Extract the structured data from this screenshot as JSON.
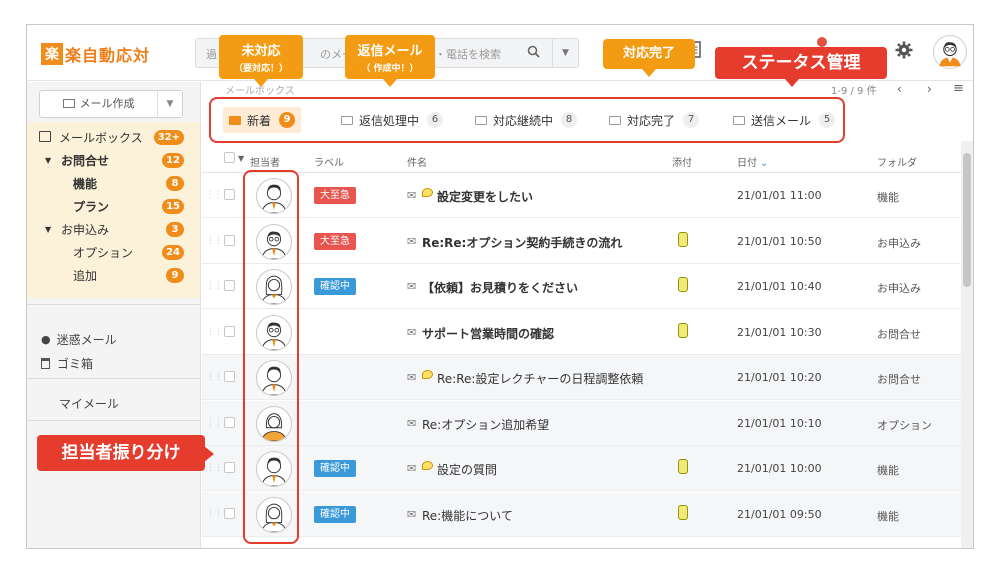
{
  "app": {
    "logo_mark": "楽",
    "logo_name": "楽自動応対"
  },
  "search": {
    "placeholder_left": "過",
    "placeholder_mid": "のメー",
    "placeholder_right": "ル・電話を検索"
  },
  "sidebar": {
    "compose_label": "メール作成",
    "folders": [
      {
        "label": "メールボックス",
        "count": "32+"
      },
      {
        "label": "お問合せ",
        "count": "12"
      },
      {
        "label": "機能",
        "count": "8"
      },
      {
        "label": "プラン",
        "count": "15"
      },
      {
        "label": "お申込み",
        "count": "3"
      },
      {
        "label": "オプション",
        "count": "24"
      },
      {
        "label": "追加",
        "count": "9"
      }
    ],
    "spam": "迷惑メール",
    "trash": "ゴミ箱",
    "my_mail": "マイメール"
  },
  "breadcrumb": "メールボックス",
  "pager": "1-9 / 9 件",
  "status_tabs": [
    {
      "label": "新着",
      "count": "9",
      "active": true
    },
    {
      "label": "返信処理中",
      "count": "6",
      "active": false
    },
    {
      "label": "対応継続中",
      "count": "8",
      "active": false
    },
    {
      "label": "対応完了",
      "count": "7",
      "active": false
    },
    {
      "label": "送信メール",
      "count": "5",
      "active": false
    }
  ],
  "columns": {
    "assignee": "担当者",
    "label": "ラベル",
    "subject": "件名",
    "attachment": "添付",
    "date": "日付",
    "folder": "フォルダ"
  },
  "label_colors": {
    "urgent": "#e8554e",
    "checking": "#3a9ad9"
  },
  "rows": [
    {
      "label": "大至急",
      "label_type": "urgent",
      "bubble": true,
      "subject": "設定変更をしたい",
      "unread": true,
      "attach": false,
      "date": "21/01/01  11:00",
      "folder": "機能",
      "avatar": "man-short"
    },
    {
      "label": "大至急",
      "label_type": "urgent",
      "bubble": false,
      "subject": "Re:Re:オプション契約手続きの流れ",
      "unread": true,
      "attach": true,
      "date": "21/01/01  10:50",
      "folder": "お申込み",
      "avatar": "man-glasses"
    },
    {
      "label": "確認中",
      "label_type": "checking",
      "bubble": false,
      "subject": "【依頼】お見積りをください",
      "unread": true,
      "attach": true,
      "date": "21/01/01  10:40",
      "folder": "お申込み",
      "avatar": "woman-long"
    },
    {
      "label": "",
      "label_type": "",
      "bubble": false,
      "subject": "サポート営業時間の確認",
      "unread": true,
      "attach": true,
      "date": "21/01/01  10:30",
      "folder": "お問合せ",
      "avatar": "man-glasses"
    },
    {
      "label": "",
      "label_type": "",
      "bubble": true,
      "subject": "Re:Re:設定レクチャーの日程調整依頼",
      "unread": false,
      "attach": false,
      "date": "21/01/01  10:20",
      "folder": "お問合せ",
      "avatar": "man-short"
    },
    {
      "label": "",
      "label_type": "",
      "bubble": false,
      "subject": "Re:オプション追加希望",
      "unread": false,
      "attach": false,
      "date": "21/01/01  10:10",
      "folder": "オプション",
      "avatar": "woman-bob"
    },
    {
      "label": "確認中",
      "label_type": "checking",
      "bubble": true,
      "subject": "設定の質問",
      "unread": false,
      "attach": true,
      "date": "21/01/01  10:00",
      "folder": "機能",
      "avatar": "man-short"
    },
    {
      "label": "確認中",
      "label_type": "checking",
      "bubble": false,
      "subject": "Re:機能について",
      "unread": false,
      "attach": true,
      "date": "21/01/01  09:50",
      "folder": "機能",
      "avatar": "woman-long"
    }
  ],
  "annotations": {
    "unhandled": {
      "title": "未対応",
      "sub": "（要対応！）"
    },
    "replying": {
      "title": "返信メール",
      "sub": "（ 作成中！）"
    },
    "done": {
      "title": "対応完了"
    },
    "status": {
      "title": "ステータス管理"
    },
    "assign": {
      "title": "担当者振り分け"
    }
  },
  "colors": {
    "brand": "#f08c1a",
    "annotation_red": "#e53c2e"
  }
}
